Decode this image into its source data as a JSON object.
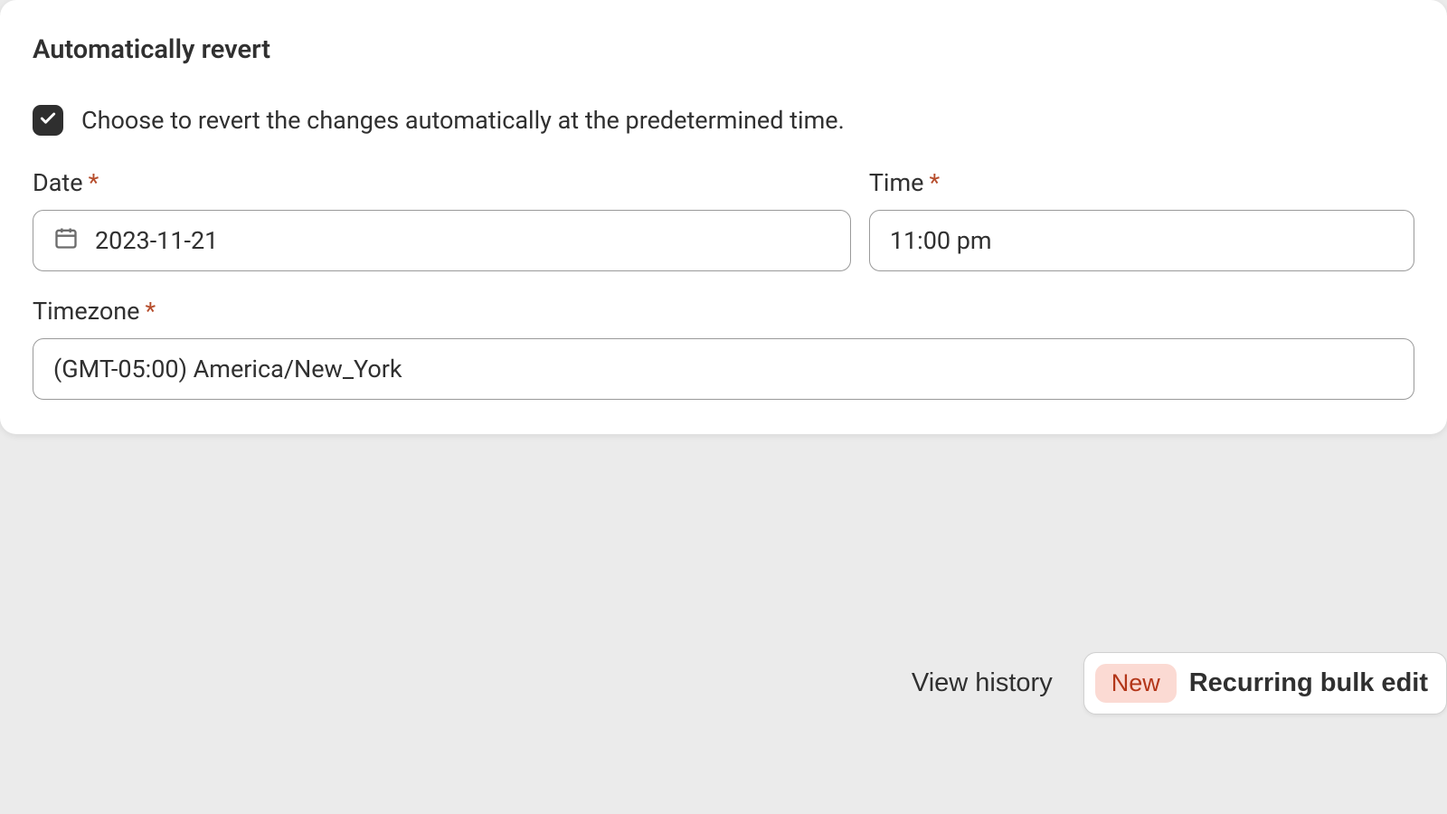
{
  "card": {
    "title": "Automatically revert",
    "checkbox": {
      "checked": true,
      "label": "Choose to revert the changes automatically at the predetermined time."
    },
    "fields": {
      "date": {
        "label": "Date",
        "value": "2023-11-21"
      },
      "time": {
        "label": "Time",
        "value": "11:00 pm"
      },
      "timezone": {
        "label": "Timezone",
        "value": "(GMT-05:00) America/New_York"
      }
    },
    "required_marker": "*"
  },
  "footer": {
    "view_history": "View history",
    "recurring": {
      "badge": "New",
      "label": "Recurring bulk edit"
    }
  }
}
